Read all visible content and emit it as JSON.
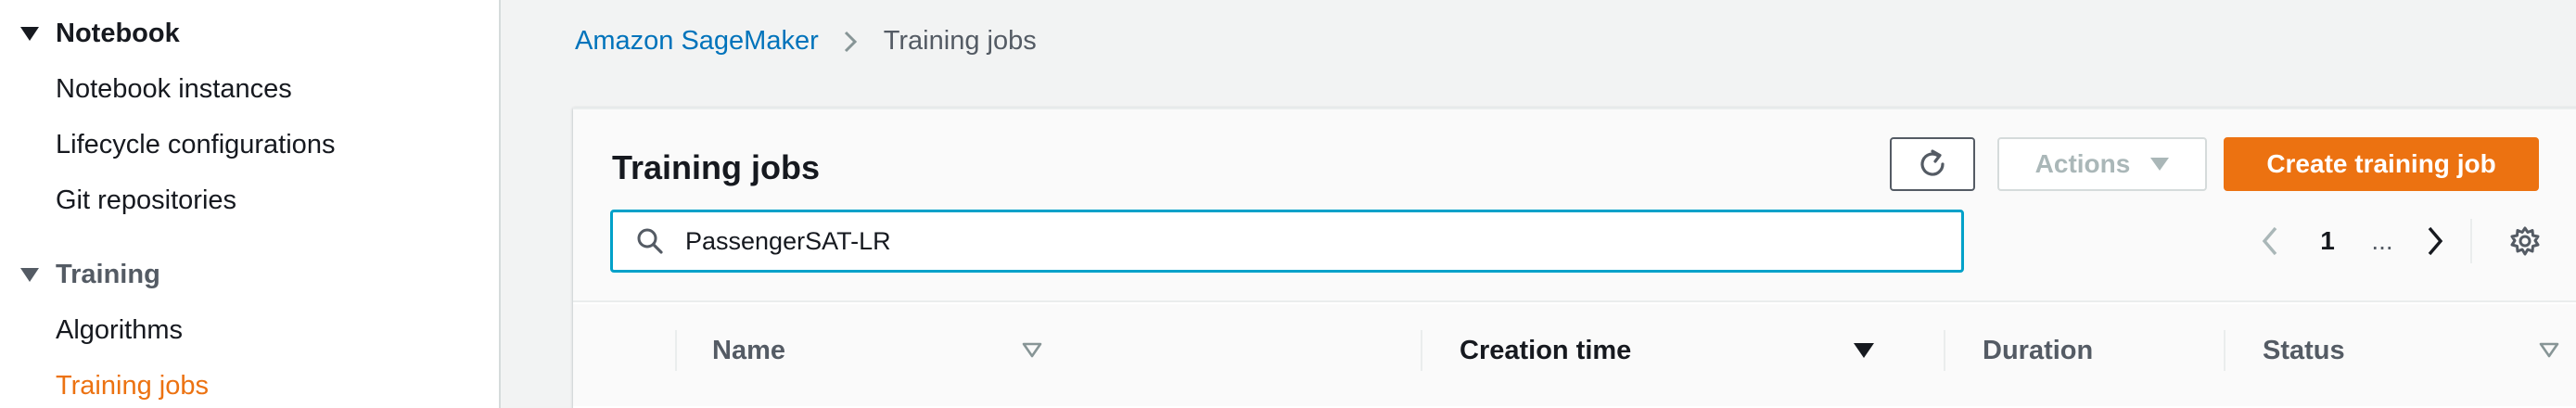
{
  "sidebar": {
    "sections": [
      {
        "title": "Notebook",
        "items": [
          "Notebook instances",
          "Lifecycle configurations",
          "Git repositories"
        ]
      },
      {
        "title": "Training",
        "items": [
          "Algorithms",
          "Training jobs"
        ]
      }
    ],
    "active_item": "Training jobs"
  },
  "breadcrumb": {
    "root": "Amazon SageMaker",
    "current": "Training jobs"
  },
  "panel": {
    "title": "Training jobs",
    "actions_label": "Actions",
    "create_label": "Create training job",
    "search_value": "PassengerSAT-LR",
    "refresh_icon": "refresh-icon",
    "search_icon": "search-icon"
  },
  "pagination": {
    "current_page": "1",
    "ellipsis": "..."
  },
  "table": {
    "columns": [
      "Name",
      "Creation time",
      "Duration",
      "Status"
    ],
    "sorted_column": "Creation time"
  },
  "colors": {
    "accent": "#ec7211",
    "link": "#0073bb",
    "focus": "#00a1c9"
  }
}
